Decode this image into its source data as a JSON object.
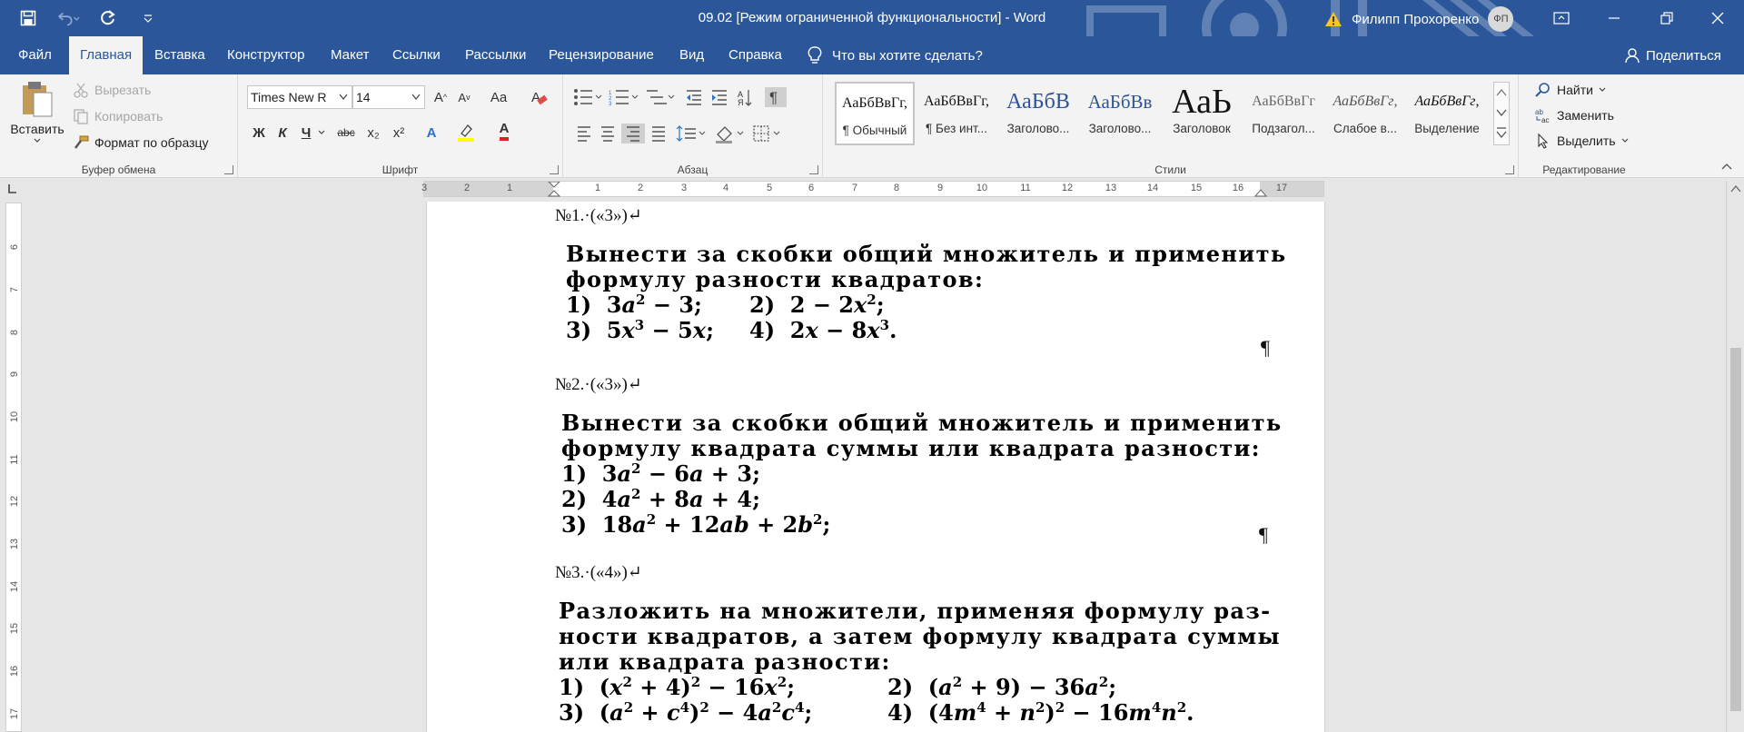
{
  "window": {
    "title": "09.02 [Режим ограниченной функциональности]  -  Word",
    "user_name": "Филипп Прохоренко",
    "user_initials": "ФП"
  },
  "tabs": [
    {
      "label": "Файл"
    },
    {
      "label": "Главная"
    },
    {
      "label": "Вставка"
    },
    {
      "label": "Конструктор"
    },
    {
      "label": "Макет"
    },
    {
      "label": "Ссылки"
    },
    {
      "label": "Рассылки"
    },
    {
      "label": "Рецензирование"
    },
    {
      "label": "Вид"
    },
    {
      "label": "Справка"
    }
  ],
  "tell_me": "Что вы хотите сделать?",
  "share": "Поделиться",
  "clipboard": {
    "paste": "Вставить",
    "cut": "Вырезать",
    "copy": "Копировать",
    "format_painter": "Формат по образцу",
    "label": "Буфер обмена"
  },
  "font": {
    "name": "Times New R",
    "size": "14",
    "label": "Шрифт",
    "bold": "Ж",
    "italic": "К",
    "underline": "Ч",
    "strike": "abc",
    "subscript": "x₂",
    "superscript": "x²",
    "grow": "A",
    "shrink": "A",
    "case": "Aa",
    "text_effects": "A",
    "font_color": "A"
  },
  "paragraph": {
    "label": "Абзац"
  },
  "styles": {
    "label": "Стили",
    "items": [
      {
        "sample": "АаБбВвГг,",
        "name": "¶ Обычный"
      },
      {
        "sample": "АаБбВвГг,",
        "name": "¶ Без инт..."
      },
      {
        "sample": "АаБбВ",
        "name": "Заголово..."
      },
      {
        "sample": "АаБбВв",
        "name": "Заголово..."
      },
      {
        "sample": "АаЬ",
        "name": "Заголовок"
      },
      {
        "sample": "АаБбВвГг",
        "name": "Подзагол..."
      },
      {
        "sample": "АаБбВвГг,",
        "name": "Слабое в..."
      },
      {
        "sample": "АаБбВвГг,",
        "name": "Выделение"
      }
    ]
  },
  "editing": {
    "label": "Редактирование",
    "find": "Найти",
    "replace": "Заменить",
    "select": "Выделить"
  },
  "ruler": {
    "h_labels": [
      "3",
      "2",
      "1",
      "1",
      "2",
      "3",
      "4",
      "5",
      "6",
      "7",
      "8",
      "9",
      "10",
      "11",
      "12",
      "13",
      "14",
      "15",
      "16",
      "17"
    ],
    "v_labels": [
      "6",
      "7",
      "8",
      "9",
      "10",
      "11",
      "12",
      "13",
      "14",
      "15",
      "16",
      "17"
    ]
  },
  "document": {
    "tasks": [
      {
        "heading": "№1.·(«3»)↵",
        "text_lines": [
          "Вынести за скобки общий множитель и применить",
          "формулу разности квадратов:"
        ],
        "pilcrow": "¶"
      },
      {
        "heading": "№2.·(«3»)↵",
        "text_lines": [
          "Вынести за скобки общий множитель и применить",
          "формулу квадрата суммы или квадрата разности:"
        ],
        "pilcrow": "¶"
      },
      {
        "heading": "№3.·(«4»)↵",
        "text_lines": [
          "Разложить на множители, применяя формулу раз-",
          "ности квадратов, а затем формулу квадрата суммы",
          "или квадрата разности:"
        ]
      }
    ]
  }
}
